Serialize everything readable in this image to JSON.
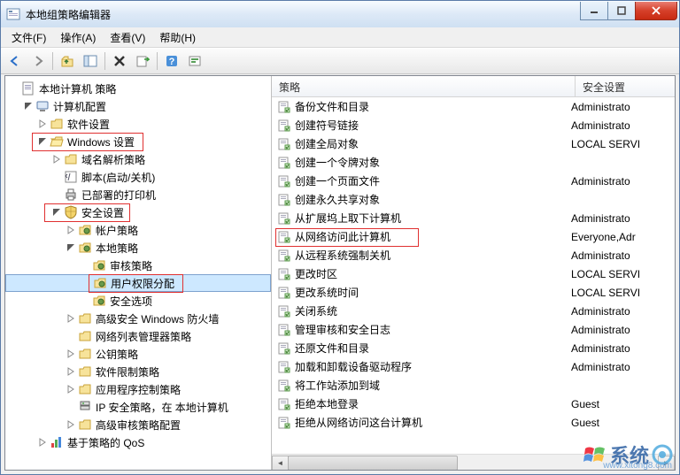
{
  "window": {
    "title": "本地组策略编辑器"
  },
  "menu": {
    "file": "文件(F)",
    "action": "操作(A)",
    "view": "查看(V)",
    "help": "帮助(H)"
  },
  "tree": {
    "root": "本地计算机 策略",
    "computer_config": "计算机配置",
    "software_settings": "软件设置",
    "windows_settings": "Windows 设置",
    "dns_policy": "域名解析策略",
    "scripts": "脚本(启动/关机)",
    "printers": "已部署的打印机",
    "security_settings": "安全设置",
    "account_policy": "帐户策略",
    "local_policy": "本地策略",
    "audit_policy": "审核策略",
    "user_rights": "用户权限分配",
    "security_options": "安全选项",
    "firewall": "高级安全 Windows 防火墙",
    "nlm_policy": "网络列表管理器策略",
    "pubkey_policy": "公钥策略",
    "software_restrict": "软件限制策略",
    "app_control": "应用程序控制策略",
    "ipsec": "IP 安全策略，在 本地计算机",
    "adv_audit": "高级审核策略配置",
    "qos": "基于策略的 QoS"
  },
  "columns": {
    "policy": "策略",
    "security_setting": "安全设置"
  },
  "items": [
    {
      "name": "备份文件和目录",
      "setting": "Administrato"
    },
    {
      "name": "创建符号链接",
      "setting": "Administrato"
    },
    {
      "name": "创建全局对象",
      "setting": "LOCAL SERVI"
    },
    {
      "name": "创建一个令牌对象",
      "setting": ""
    },
    {
      "name": "创建一个页面文件",
      "setting": "Administrato"
    },
    {
      "name": "创建永久共享对象",
      "setting": ""
    },
    {
      "name": "从扩展坞上取下计算机",
      "setting": "Administrato"
    },
    {
      "name": "从网络访问此计算机",
      "setting": "Everyone,Adr",
      "hl": true
    },
    {
      "name": "从远程系统强制关机",
      "setting": "Administrato"
    },
    {
      "name": "更改时区",
      "setting": "LOCAL SERVI"
    },
    {
      "name": "更改系统时间",
      "setting": "LOCAL SERVI"
    },
    {
      "name": "关闭系统",
      "setting": "Administrato"
    },
    {
      "name": "管理审核和安全日志",
      "setting": "Administrato"
    },
    {
      "name": "还原文件和目录",
      "setting": "Administrato"
    },
    {
      "name": "加载和卸载设备驱动程序",
      "setting": "Administrato"
    },
    {
      "name": "将工作站添加到域",
      "setting": ""
    },
    {
      "name": "拒绝本地登录",
      "setting": "Guest"
    },
    {
      "name": "拒绝从网络访问这台计算机",
      "setting": "Guest"
    }
  ],
  "watermark": {
    "text": "系统",
    "url": "www.xitong8.com"
  }
}
